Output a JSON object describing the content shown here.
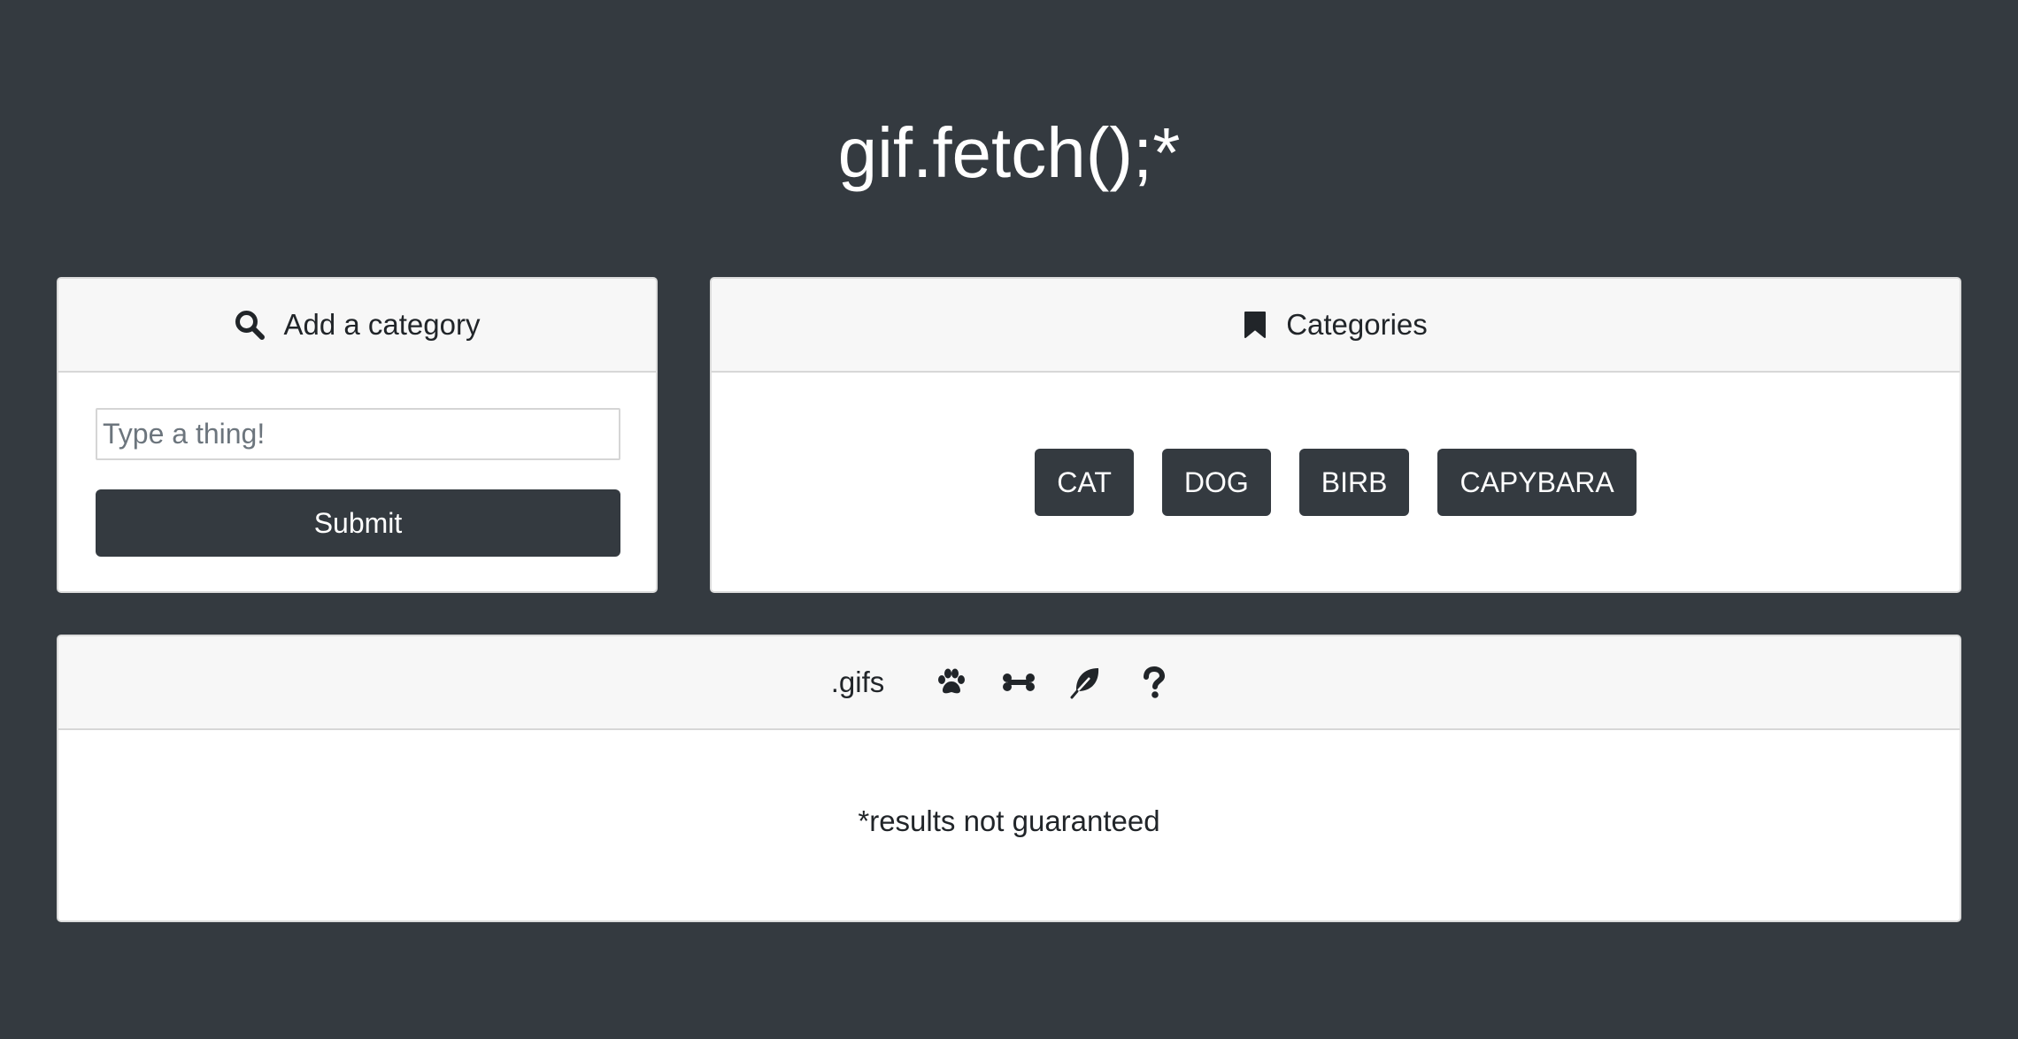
{
  "app": {
    "title": "gif.fetch();*"
  },
  "add_category": {
    "header_icon": "search-icon",
    "header_label": "Add a category",
    "input_placeholder": "Type a thing!",
    "input_value": "",
    "submit_label": "Submit"
  },
  "categories": {
    "header_icon": "bookmark-icon",
    "header_label": "Categories",
    "items": [
      "CAT",
      "DOG",
      "BIRB",
      "CAPYBARA"
    ]
  },
  "gifs": {
    "header_label": ".gifs",
    "filter_icons": [
      "paw-icon",
      "bone-icon",
      "feather-icon",
      "question-icon"
    ],
    "results_note": "*results not guaranteed"
  },
  "colors": {
    "background": "#343a40",
    "card_header": "#f7f7f7",
    "button": "#343a40",
    "text": "#212529"
  }
}
